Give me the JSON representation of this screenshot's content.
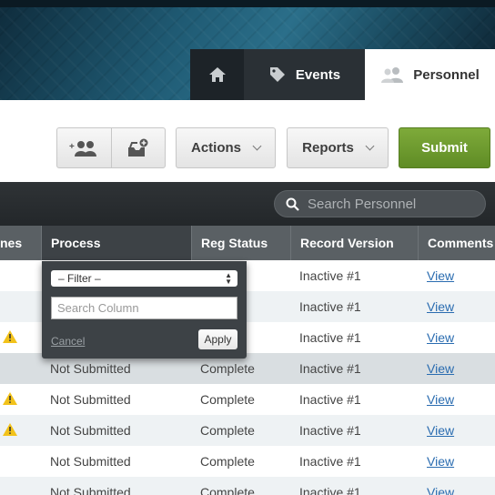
{
  "nav": {
    "tabs": [
      {
        "label": ""
      },
      {
        "label": "Events"
      },
      {
        "label": "Personnel"
      }
    ]
  },
  "toolbar": {
    "actions_label": "Actions",
    "reports_label": "Reports",
    "submit_label": "Submit"
  },
  "search": {
    "placeholder": "Search Personnel"
  },
  "table": {
    "columns": [
      "nes",
      "Process",
      "Reg Status",
      "Record Version",
      "Comments"
    ],
    "rows": [
      {
        "warn": false,
        "process": "",
        "reg_status": "e",
        "record_version": "Inactive #1",
        "comments": "View"
      },
      {
        "warn": false,
        "process": "",
        "reg_status": "e",
        "record_version": "Inactive #1",
        "comments": "View"
      },
      {
        "warn": true,
        "process": "",
        "reg_status": "e",
        "record_version": "Inactive #1",
        "comments": "View"
      },
      {
        "warn": false,
        "process": "Not Submitted",
        "reg_status": "Complete",
        "record_version": "Inactive #1",
        "comments": "View"
      },
      {
        "warn": true,
        "process": "Not Submitted",
        "reg_status": "Complete",
        "record_version": "Inactive #1",
        "comments": "View"
      },
      {
        "warn": true,
        "process": "Not Submitted",
        "reg_status": "Complete",
        "record_version": "Inactive #1",
        "comments": "View"
      },
      {
        "warn": false,
        "process": "Not Submitted",
        "reg_status": "Complete",
        "record_version": "Inactive #1",
        "comments": "View"
      },
      {
        "warn": false,
        "process": "Not Submitted",
        "reg_status": "Complete",
        "record_version": "Inactive #1",
        "comments": "View"
      }
    ]
  },
  "filter_popup": {
    "select_value": "– Filter –",
    "search_placeholder": "Search Column",
    "cancel_label": "Cancel",
    "apply_label": "Apply"
  },
  "colors": {
    "accent_green": "#6a9a2e",
    "warning": "#f2c21a",
    "link": "#2a6cb0"
  }
}
